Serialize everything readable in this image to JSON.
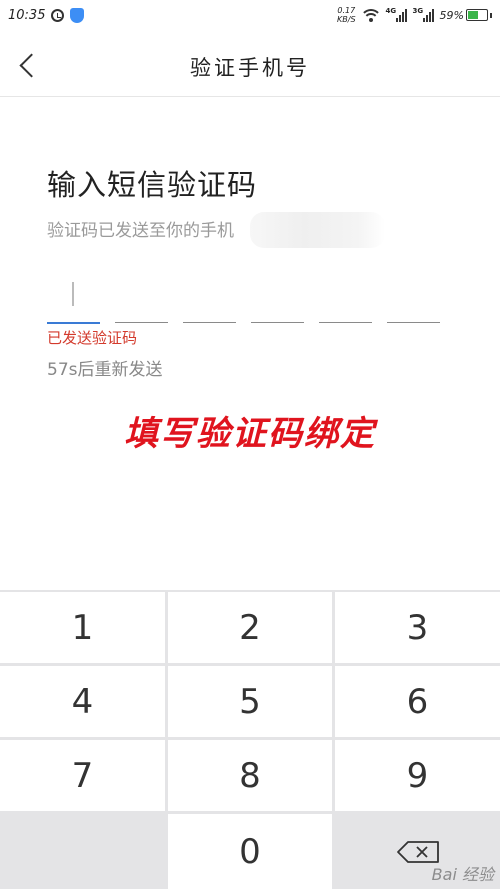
{
  "status_bar": {
    "time": "10:35",
    "speed_value": "0.17",
    "speed_unit": "KB/S",
    "signal1_label": "4G",
    "signal2_label": "3G",
    "battery": "59%",
    "icons": [
      "alarm-icon",
      "shield-icon",
      "wifi-icon",
      "signal-icon",
      "battery-icon"
    ]
  },
  "header": {
    "title": "验证手机号",
    "back_icon": "chevron-left-icon"
  },
  "main": {
    "heading": "输入短信验证码",
    "subtext": "验证码已发送至你的手机",
    "code_slots": [
      "",
      "",
      "",
      "",
      "",
      ""
    ],
    "sent_hint": "已发送验证码",
    "resend_countdown": "57s后重新发送",
    "annotation": "填写验证码绑定"
  },
  "keypad": {
    "keys": [
      "1",
      "2",
      "3",
      "4",
      "5",
      "6",
      "7",
      "8",
      "9",
      "",
      "0",
      "delete"
    ],
    "delete_icon": "backspace-icon"
  },
  "watermark": "Bai 经验",
  "colors": {
    "accent_blue": "#3a7bd5",
    "hint_red": "#d33a2c",
    "annotation_red": "#e0141e",
    "battery_green": "#3bb54a"
  }
}
